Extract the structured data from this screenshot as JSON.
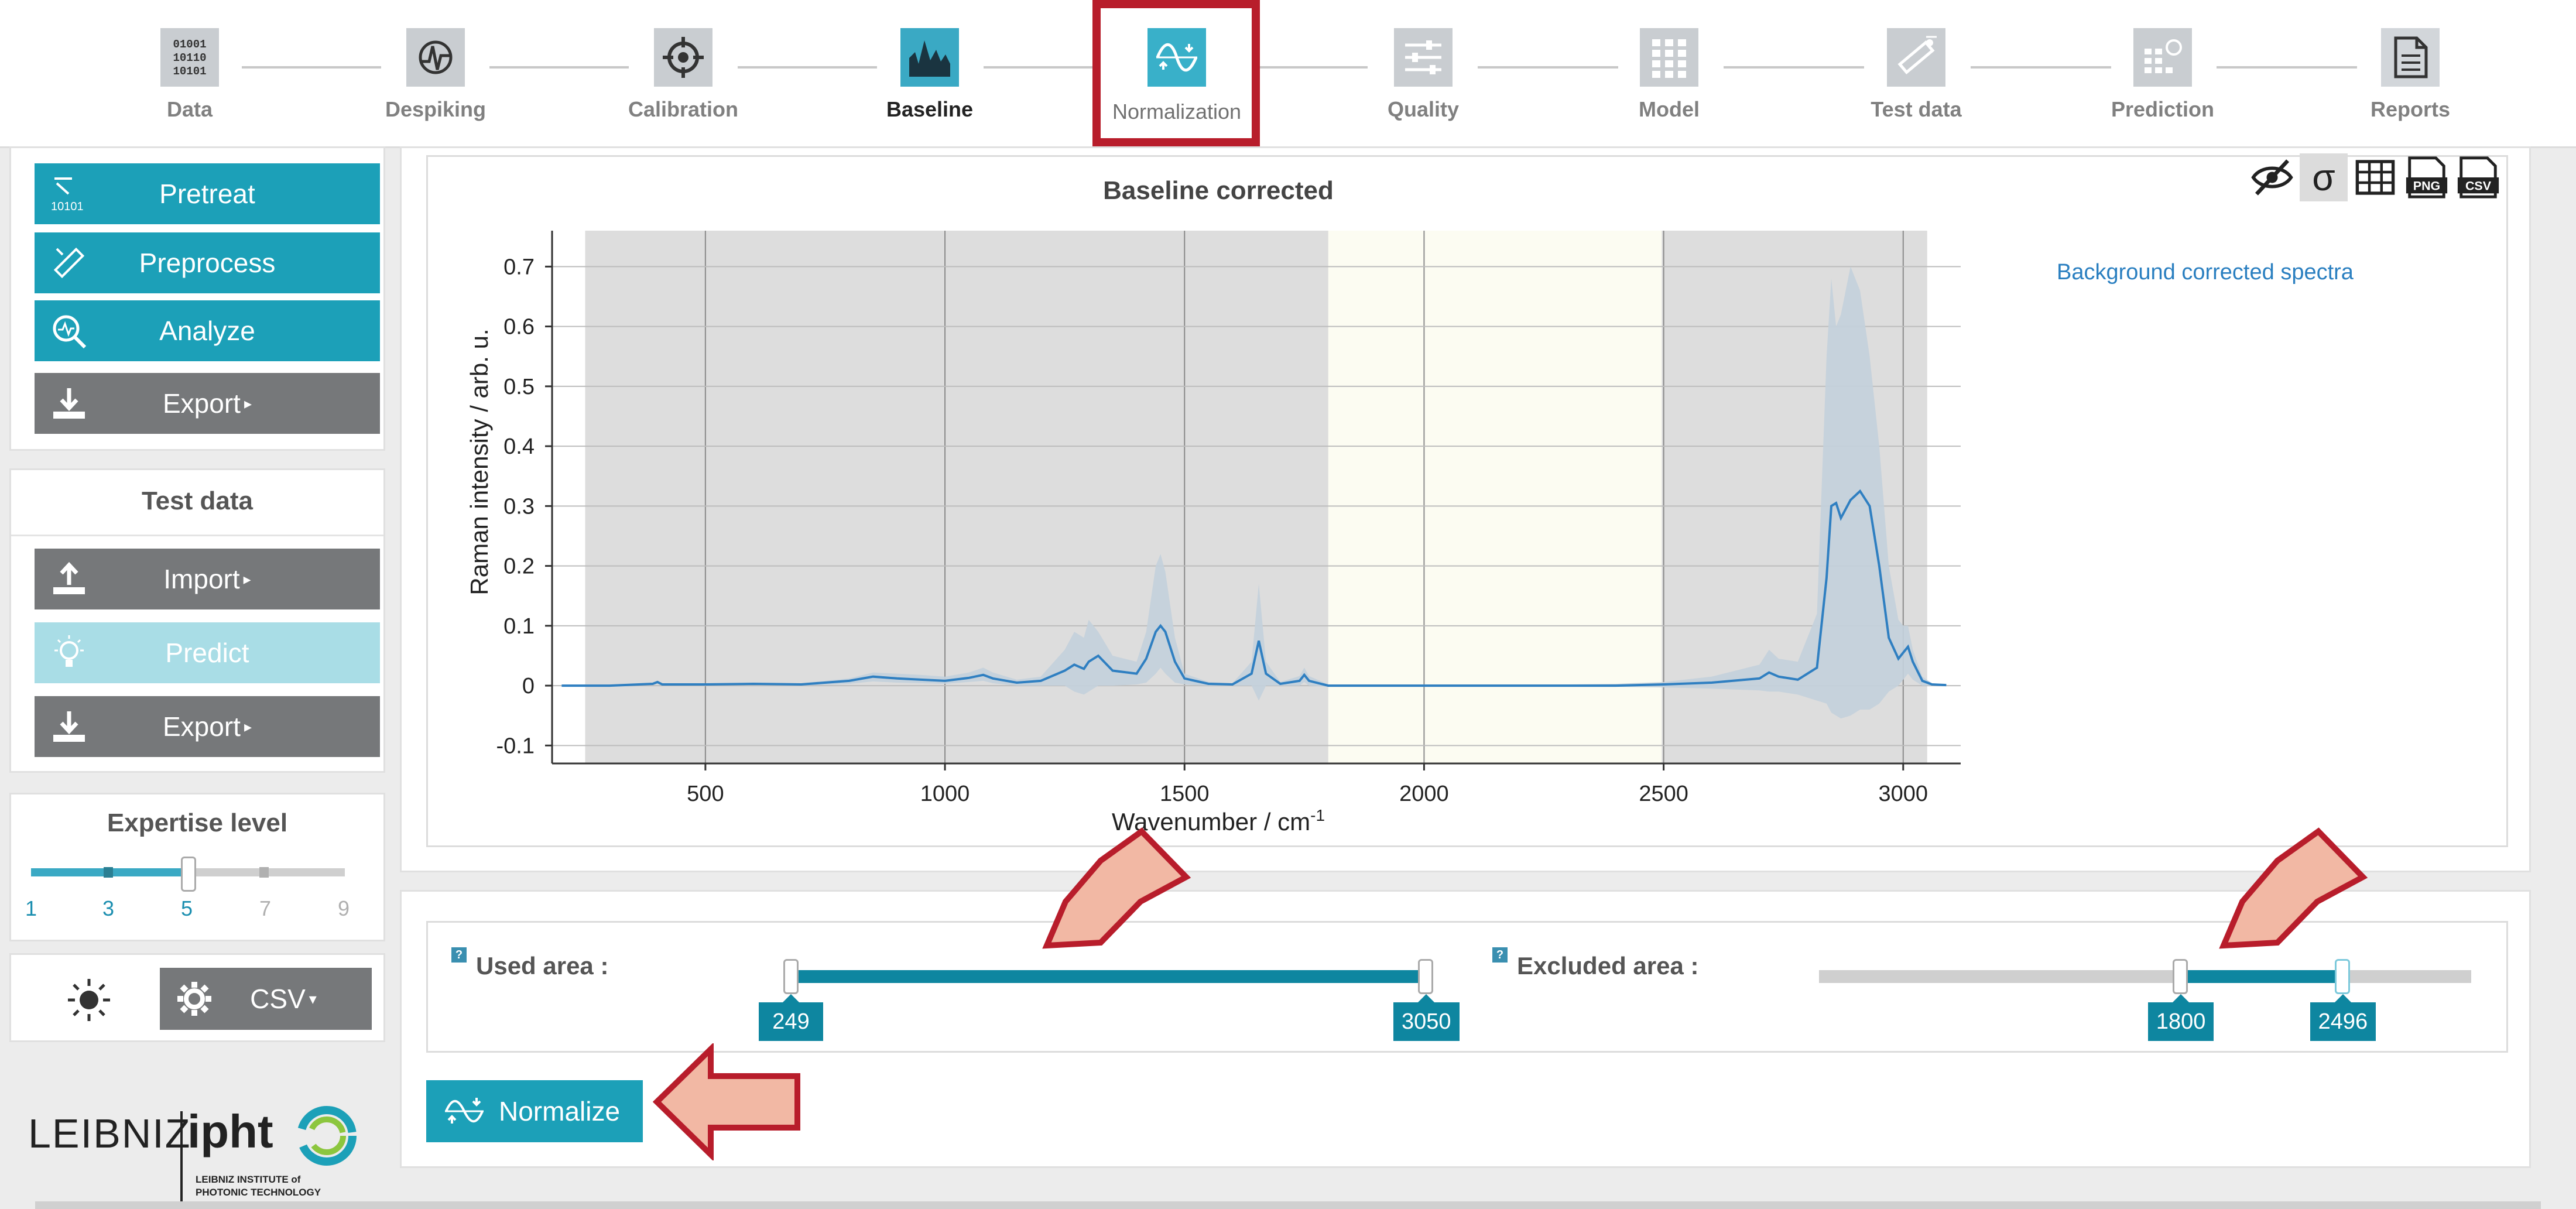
{
  "steps": [
    {
      "label": "Data",
      "icon": "binary-data-icon"
    },
    {
      "label": "Despiking",
      "icon": "despiking-icon"
    },
    {
      "label": "Calibration",
      "icon": "calibration-target-icon"
    },
    {
      "label": "Baseline",
      "icon": "baseline-chart-icon"
    },
    {
      "label": "Normalization",
      "icon": "normalization-wave-icon"
    },
    {
      "label": "Quality",
      "icon": "quality-sliders-icon"
    },
    {
      "label": "Model",
      "icon": "model-grid-icon"
    },
    {
      "label": "Test data",
      "icon": "test-data-icon"
    },
    {
      "label": "Prediction",
      "icon": "prediction-icon"
    },
    {
      "label": "Reports",
      "icon": "report-document-icon"
    }
  ],
  "sidebar": {
    "pretreat_label": "Pretreat",
    "preprocess_label": "Preprocess",
    "analyze_label": "Analyze",
    "export_label": "Export",
    "test_data_title": "Test data",
    "import_label": "Import",
    "predict_label": "Predict",
    "export2_label": "Export",
    "expertise_title": "Expertise level",
    "expertise_ticks": [
      "1",
      "3",
      "5",
      "7",
      "9"
    ],
    "expertise_value": 5,
    "csv_label": "CSV",
    "pretreat_icon_text": "10101"
  },
  "chart": {
    "toolbar_png": "PNG",
    "toolbar_csv": "CSV",
    "toolbar_sigma": "σ",
    "legend_entry": "Background corrected spectra"
  },
  "chart_data": {
    "type": "line",
    "title": "Baseline corrected",
    "xlabel": "Wavenumber / cm",
    "xlabel_sup": "-1",
    "ylabel": "Raman intensity / arb. u.",
    "xlim": [
      180,
      3120
    ],
    "ylim": [
      -0.13,
      0.76
    ],
    "xticks": [
      500,
      1000,
      1500,
      2000,
      2500,
      3000
    ],
    "yticks": [
      -0.1,
      0,
      0.1,
      0.2,
      0.3,
      0.4,
      0.5,
      0.6,
      0.7
    ],
    "ytick_labels": [
      "-0.1",
      "0",
      "0.1",
      "0.2",
      "0.3",
      "0.4",
      "0.5",
      "0.6",
      "0.7"
    ],
    "grid": true,
    "used_area": [
      249,
      3050
    ],
    "excluded_area": [
      1800,
      2496
    ],
    "series": [
      {
        "name": "Background corrected spectra",
        "x": [
          200,
          300,
          390,
          400,
          410,
          500,
          600,
          700,
          800,
          850,
          900,
          950,
          1000,
          1050,
          1080,
          1100,
          1150,
          1200,
          1250,
          1270,
          1290,
          1300,
          1320,
          1350,
          1400,
          1420,
          1440,
          1450,
          1460,
          1480,
          1500,
          1550,
          1600,
          1640,
          1655,
          1670,
          1700,
          1740,
          1750,
          1760,
          1800,
          1900,
          2000,
          2100,
          2200,
          2300,
          2400,
          2500,
          2600,
          2700,
          2720,
          2740,
          2780,
          2820,
          2840,
          2850,
          2860,
          2870,
          2890,
          2910,
          2930,
          2950,
          2970,
          2990,
          3000,
          3010,
          3020,
          3040,
          3060,
          3090
        ],
        "y": [
          0,
          0,
          0.003,
          0.006,
          0.002,
          0.002,
          0.003,
          0.002,
          0.008,
          0.015,
          0.012,
          0.01,
          0.008,
          0.013,
          0.018,
          0.012,
          0.005,
          0.008,
          0.025,
          0.035,
          0.028,
          0.04,
          0.05,
          0.025,
          0.02,
          0.045,
          0.09,
          0.1,
          0.09,
          0.04,
          0.012,
          0.003,
          0.002,
          0.02,
          0.075,
          0.02,
          0.003,
          0.008,
          0.018,
          0.008,
          0.0,
          0.0,
          0.0,
          0.0,
          0.0,
          0.0,
          0.0,
          0.002,
          0.005,
          0.012,
          0.022,
          0.015,
          0.01,
          0.03,
          0.18,
          0.3,
          0.305,
          0.28,
          0.31,
          0.325,
          0.3,
          0.2,
          0.08,
          0.045,
          0.055,
          0.065,
          0.04,
          0.008,
          0.002,
          0.001
        ],
        "band_upper": [
          0,
          0,
          0.004,
          0.008,
          0.003,
          0.003,
          0.004,
          0.004,
          0.012,
          0.022,
          0.02,
          0.018,
          0.015,
          0.022,
          0.03,
          0.022,
          0.01,
          0.015,
          0.06,
          0.09,
          0.08,
          0.11,
          0.09,
          0.05,
          0.04,
          0.09,
          0.2,
          0.22,
          0.19,
          0.08,
          0.02,
          0.006,
          0.004,
          0.04,
          0.17,
          0.04,
          0.006,
          0.016,
          0.03,
          0.016,
          0.002,
          0.002,
          0.002,
          0.002,
          0.002,
          0.002,
          0.003,
          0.006,
          0.015,
          0.035,
          0.06,
          0.045,
          0.04,
          0.12,
          0.55,
          0.68,
          0.6,
          0.62,
          0.7,
          0.66,
          0.55,
          0.4,
          0.2,
          0.11,
          0.1,
          0.1,
          0.06,
          0.015,
          0.004,
          0.002
        ],
        "band_lower": [
          0,
          0,
          0.001,
          0.003,
          0.001,
          0.001,
          0.001,
          0.0,
          0.003,
          0.007,
          0.005,
          0.004,
          0.003,
          0.006,
          0.008,
          0.004,
          0.0,
          0.0,
          0.0,
          -0.01,
          -0.015,
          -0.01,
          0.0,
          0.0,
          0.002,
          0.005,
          0.02,
          0.03,
          0.02,
          0.005,
          0.002,
          0.0,
          0.0,
          0.0,
          -0.025,
          0.0,
          0.0,
          0.0,
          0.006,
          0.0,
          -0.002,
          -0.002,
          -0.002,
          -0.002,
          -0.002,
          -0.002,
          -0.002,
          -0.003,
          -0.005,
          -0.008,
          -0.01,
          -0.01,
          -0.015,
          -0.025,
          -0.03,
          -0.045,
          -0.05,
          -0.055,
          -0.05,
          -0.04,
          -0.04,
          -0.03,
          -0.01,
          0.0,
          0.01,
          0.02,
          0.01,
          0.0,
          0.0,
          0.0
        ]
      }
    ],
    "colors": {
      "line": "#2f7fc1",
      "band": "#c3d0dc",
      "excluded": "#dddddd",
      "used": "#fcfcf2"
    }
  },
  "used_area": {
    "label": "Used area :",
    "min_label": "249",
    "max_label": "3050",
    "range": [
      249,
      3050
    ],
    "slider_min": 249,
    "slider_max": 3050
  },
  "excluded_area": {
    "label": "Excluded area :",
    "min_label": "1800",
    "max_label": "2496",
    "range": [
      1800,
      2496
    ]
  },
  "help_badge": "?",
  "normalize_label": "Normalize",
  "logo": {
    "word1": "LEIBNIZ",
    "word2": "ipht",
    "tagline1": "LEIBNIZ INSTITUTE of",
    "tagline2": "PHOTONIC TECHNOLOGY"
  },
  "colors": {
    "accent": "#1ca0b8",
    "button_grey": "#76787a",
    "highlight_red": "#b81d2b",
    "arrow_fill": "#f2b8a4"
  }
}
